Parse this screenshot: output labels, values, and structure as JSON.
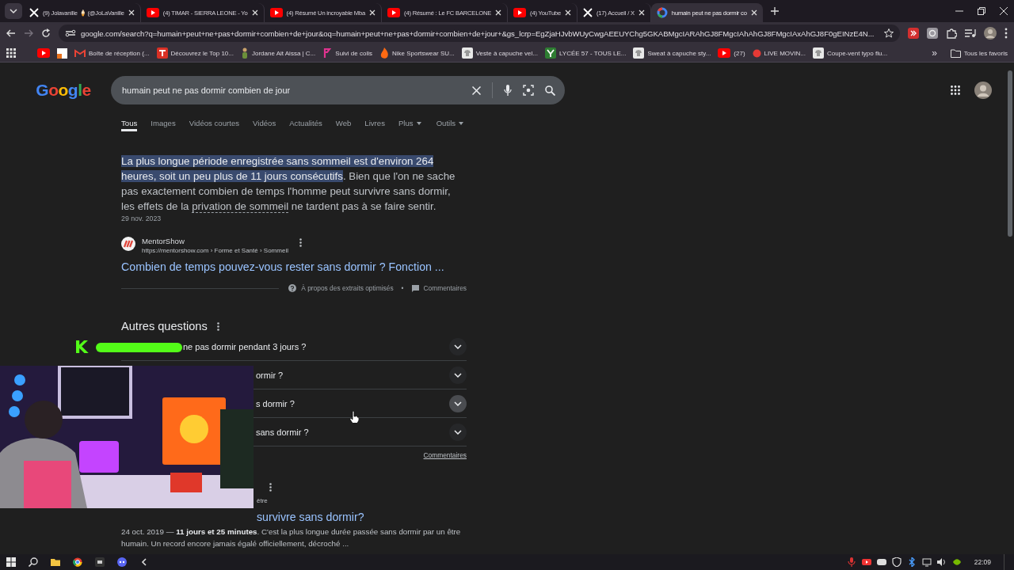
{
  "browser": {
    "tabs": [
      {
        "kind": "x",
        "title": "(9) Jolavanille 🍦 (@JoLaVanille",
        "selected": false
      },
      {
        "kind": "youtube",
        "title": "(4) TIMAR - SIERRA LEONE - Yo",
        "selected": false
      },
      {
        "kind": "youtube",
        "title": "(4) Résumé Un incroyable Mba",
        "selected": false
      },
      {
        "kind": "youtube",
        "title": "(4) Résumé : Le FC BARCELONE",
        "selected": false
      },
      {
        "kind": "youtube",
        "title": "(4) YouTube",
        "selected": false
      },
      {
        "kind": "x",
        "title": "(17) Accueil / X",
        "selected": false
      },
      {
        "kind": "google",
        "title": "humain peut ne pas dormir co",
        "selected": true
      }
    ],
    "address": "google.com/search?q=humain+peut+ne+pas+dormir+combien+de+jour&oq=humain+peut+ne+pas+dormir+combien+de+jour+&gs_lcrp=EgZjaHJvbWUyCwgAEEUYChg5GKABMgcIARAhGJ8FMgcIAhAhGJ8FMgcIAxAhGJ8F0gEINzE4N...",
    "bookmarks": [
      {
        "kind": "youtube"
      },
      {
        "kind": "doc"
      },
      {
        "kind": "mail",
        "label": "Boîte de réception (..."
      },
      {
        "kind": "tl",
        "label": "Découvrez le Top 10..."
      },
      {
        "kind": "person",
        "label": "Jordane Ait Aissa | C..."
      },
      {
        "kind": "parcel",
        "label": "Suivi de colis"
      },
      {
        "kind": "flame",
        "label": "Nike Sportswear SU..."
      },
      {
        "kind": "shirt",
        "label": "Veste à capuche vel..."
      },
      {
        "kind": "lycee",
        "label": "LYCÉE 57 - TOUS LE..."
      },
      {
        "kind": "shirt",
        "label": "Sweat à capuche sty..."
      },
      {
        "kind": "youtube",
        "label": "(27)"
      },
      {
        "kind": "live",
        "label": "LIVE MOVIN..."
      },
      {
        "kind": "shirt",
        "label": "Coupe-vent typo flu..."
      }
    ],
    "more": "»",
    "all_bookmarks": "Tous les favoris"
  },
  "google": {
    "logo": "Google",
    "query": "humain peut ne pas dormir combien de jour",
    "tabs": [
      {
        "label": "Tous",
        "selected": true,
        "kind": "link"
      },
      {
        "label": "Images",
        "selected": false,
        "kind": "link"
      },
      {
        "label": "Vidéos courtes",
        "selected": false,
        "kind": "link"
      },
      {
        "label": "Vidéos",
        "selected": false,
        "kind": "link"
      },
      {
        "label": "Actualités",
        "selected": false,
        "kind": "link"
      },
      {
        "label": "Web",
        "selected": false,
        "kind": "link"
      },
      {
        "label": "Livres",
        "selected": false,
        "kind": "link"
      },
      {
        "label": "Plus",
        "selected": false,
        "kind": "menu"
      },
      {
        "label": "Outils",
        "selected": false,
        "kind": "menu"
      }
    ]
  },
  "featured": {
    "segments": [
      {
        "kind": "highlight",
        "text": "La plus longue période enregistrée sans sommeil est d'environ 264 heures, soit un peu plus de 11 jours consécutifs"
      },
      {
        "kind": "plain",
        "text": ". Bien que l'on ne sache pas exactement combien de temps l'homme peut survivre sans dormir, les effets de la "
      },
      {
        "kind": "term",
        "text": "privation de sommeil"
      },
      {
        "kind": "plain",
        "text": " ne tardent pas à se faire sentir."
      }
    ],
    "date": "29 nov. 2023",
    "site": "MentorShow",
    "url": "https://mentorshow.com › Forme et Santé › Sommeil",
    "title": "Combien de temps pouvez-vous rester sans dormir ? Fonction ...",
    "about": "À propos des extraits optimisés",
    "separator": "•",
    "feedback": "Commentaires"
  },
  "questions": {
    "title": "Autres questions",
    "items": [
      {
        "text": "ne pas dormir pendant 3 jours ?",
        "hovered": false
      },
      {
        "text": "ormir ?",
        "hovered": false
      },
      {
        "text": "s dormir ?",
        "hovered": true
      },
      {
        "text": "sans dormir ?",
        "hovered": false
      }
    ],
    "feedback": "Commentaires"
  },
  "result": {
    "breadcrumb": "être",
    "title": "survivre sans dormir?",
    "snippet": "24 oct. 2019 — **11 jours et 25 minutes**. C'est la plus longue durée passée sans dormir par un être humain. Un record encore jamais égalé officiellement, décroché ..."
  },
  "overlay": {
    "logo": "K"
  },
  "taskbar": {
    "time": "22:09"
  }
}
